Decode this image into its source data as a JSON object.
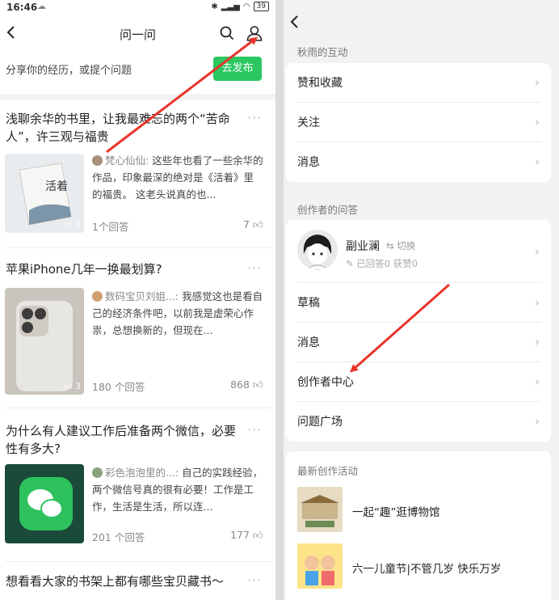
{
  "status_bar": {
    "time": "16:46",
    "battery": "39"
  },
  "left_nav": {
    "title": "问一问"
  },
  "share": {
    "prompt": "分享你的经历，或提个问题",
    "publish_label": "去发布"
  },
  "posts": [
    {
      "title": "浅聊余华的书里，让我最难忘的两个“苦命人”，许三观与福贵",
      "author": "梵心仙仙:",
      "excerpt": "这些年也看了一些余华的作品，印象最深的绝对是《活着》里的福贵。 这老头说真的也...",
      "thumb_count": "3",
      "answers": "1个回答",
      "likes": "7"
    },
    {
      "title": "苹果iPhone几年一换最划算?",
      "author": "数码宝贝刘姐...:",
      "excerpt": "我感觉这也是看自己的经济条件吧，以前我是虚荣心作祟，总想换新的，但现在...",
      "thumb_count": "3",
      "answers": "180 个回答",
      "likes": "868"
    },
    {
      "title": "为什么有人建议工作后准备两个微信，必要性有多大?",
      "author": "彩色泡泡里的...:",
      "excerpt": "自己的实践经验，两个微信号真的很有必要！工作是工作，生活是生活，所以连...",
      "answers": "201 个回答",
      "likes": "177"
    },
    {
      "title": "想看看大家的书架上都有哪些宝贝藏书～"
    }
  ],
  "right": {
    "section1_label": "秋雨的互动",
    "interaction_items": [
      "赞和收藏",
      "关注",
      "消息"
    ],
    "section2_label": "创作者的问答",
    "profile": {
      "name": "副业澜",
      "switch_label": "切换",
      "stats": "已回答0   获赞0"
    },
    "creator_items": [
      "草稿",
      "消息",
      "创作者中心",
      "问题广场"
    ],
    "section3_label": "最新创作活动",
    "activities": [
      "一起“趣”逛博物馆",
      "六一儿童节|不管几岁 快乐万岁"
    ]
  },
  "colors": {
    "accent": "#2bc760",
    "arrow": "#e8342a",
    "page_bg": "#f2f2f2"
  }
}
